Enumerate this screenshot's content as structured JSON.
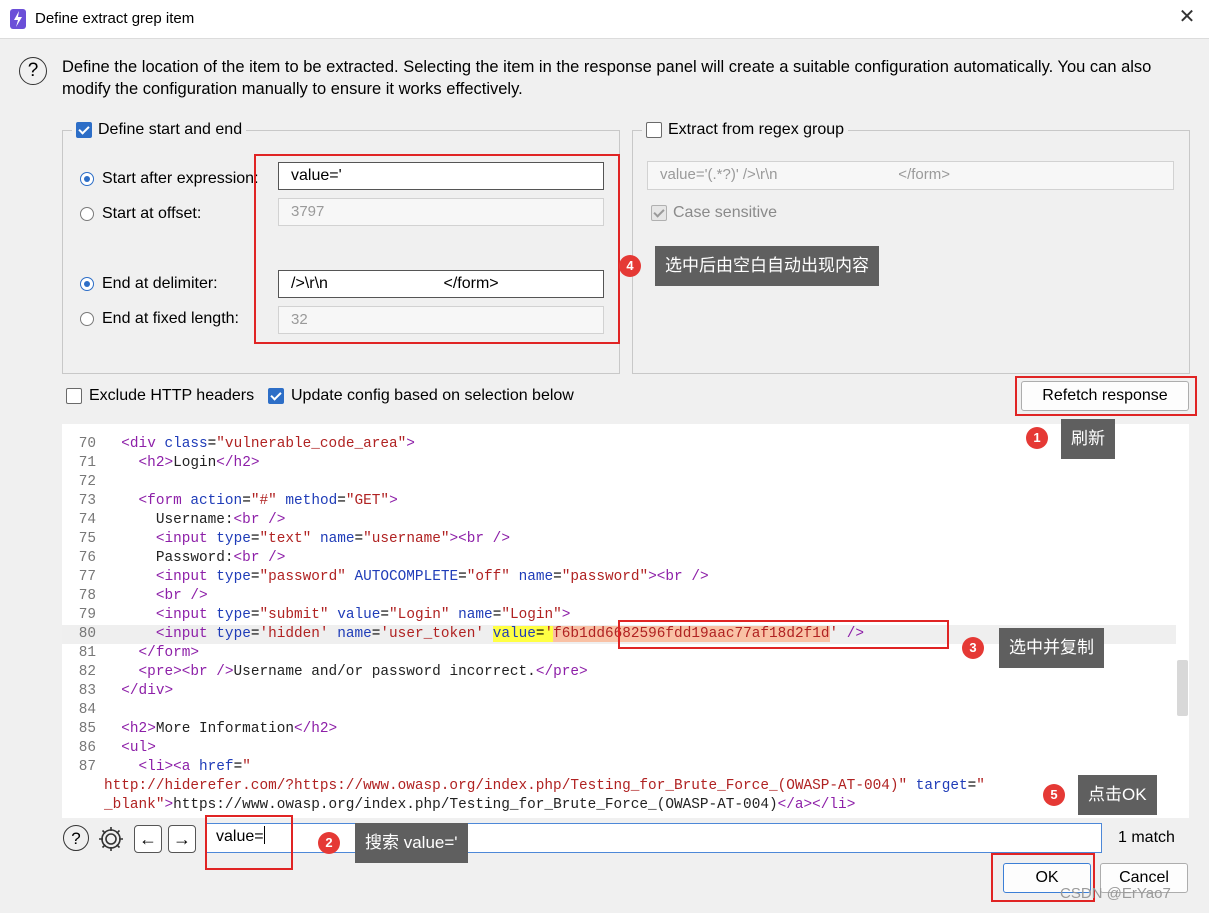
{
  "window": {
    "title": "Define extract grep item",
    "close_glyph": "✕"
  },
  "intro": "Define the location of the item to be extracted. Selecting the item in the response panel will create a suitable configuration automatically. You can also modify the configuration manually to ensure it works effectively.",
  "start_end": {
    "legend": "Define start and end",
    "checked": true,
    "start_after_label": "Start after expression:",
    "start_after_value": "value='",
    "start_offset_label": "Start at offset:",
    "start_offset_value": "3797",
    "end_delim_label": "End at delimiter:",
    "end_delim_value": "/>\\r\\n                          </form>",
    "end_fixed_label": "End at fixed length:",
    "end_fixed_value": "32"
  },
  "regex": {
    "legend": "Extract from regex group",
    "checked": false,
    "value": "value='(.*?)' />\\r\\n                             </form>",
    "case_label": "Case sensitive",
    "case_checked": true
  },
  "options": {
    "exclude_headers_label": "Exclude HTTP headers",
    "exclude_headers_checked": false,
    "update_config_label": "Update config based on selection below",
    "update_config_checked": true,
    "refetch_label": "Refetch response"
  },
  "annotations": {
    "n1": "1",
    "t1": "刷新",
    "n2": "2",
    "t2": "搜索 value='",
    "n3": "3",
    "t3": "选中并复制",
    "n4": "4",
    "t4": "选中后由空白自动出现内容",
    "n5": "5",
    "t5": "点击OK"
  },
  "code": {
    "l70n": "70",
    "l71n": "71",
    "l72n": "72",
    "l73n": "73",
    "l74n": "74",
    "l75n": "75",
    "l76n": "76",
    "l77n": "77",
    "l78n": "78",
    "l79n": "79",
    "l80n": "80",
    "l81n": "81",
    "l82n": "82",
    "l83n": "83",
    "l84n": "84",
    "l85n": "85",
    "l86n": "86",
    "l87n": "87",
    "token_value": "f6b1dd6682596fdd19aac77af18d2f1d"
  },
  "search": {
    "value": "value=",
    "match_count": "1 match"
  },
  "buttons": {
    "ok": "OK",
    "cancel": "Cancel"
  },
  "watermark": "CSDN @ErYao7"
}
